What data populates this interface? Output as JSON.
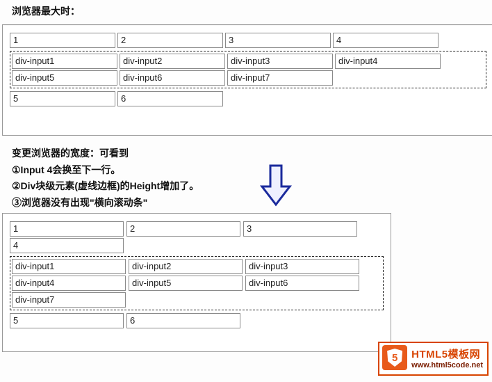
{
  "caption_top": "浏览器最大时：",
  "panel_a": {
    "row1": [
      "1",
      "2",
      "3",
      "4"
    ],
    "div_inputs": [
      "div-input1",
      "div-input2",
      "div-input3",
      "div-input4",
      "div-input5",
      "div-input6",
      "div-input7"
    ],
    "row3": [
      "5",
      "6"
    ]
  },
  "caption_mid": {
    "l1": "变更浏览器的宽度：可看到",
    "l2": "①Input 4会换至下一行。",
    "l3": "②Div块级元素(虚线边框)的Height增加了。",
    "l4": "③浏览器没有出现\"横向滚动条\""
  },
  "panel_b": {
    "row1": [
      "1",
      "2",
      "3",
      "4"
    ],
    "div_inputs": [
      "div-input1",
      "div-input2",
      "div-input3",
      "div-input4",
      "div-input5",
      "div-input6",
      "div-input7"
    ],
    "row3": [
      "5",
      "6"
    ]
  },
  "logo": {
    "badge": "5",
    "title": "HTML5模板网",
    "url": "www.html5code.net"
  },
  "colors": {
    "arrow": "#1a2a9c",
    "logo_border": "#d84400",
    "logo_bg": "#e85a1a"
  }
}
